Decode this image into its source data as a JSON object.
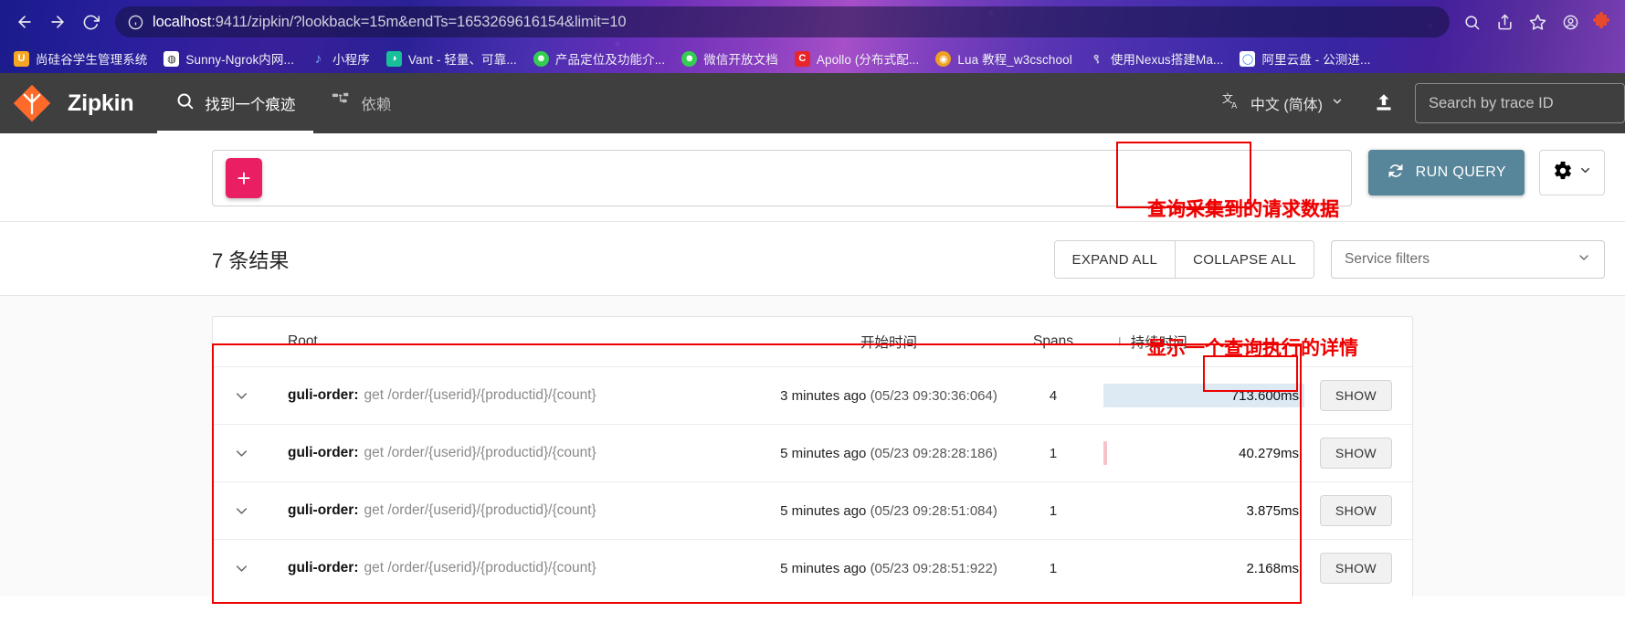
{
  "browser": {
    "back_label": "Back",
    "forward_label": "Forward",
    "reload_label": "Reload",
    "url_host": "localhost",
    "url_rest": ":9411/zipkin/?lookback=15m&endTs=1653269616154&limit=10",
    "icons": {
      "info": "info-icon",
      "zoom": "zoom-icon",
      "share": "share-icon",
      "star": "star-icon",
      "profile": "profile-icon",
      "extensions": "puzzle-icon"
    },
    "bookmarks": [
      {
        "label": "尚硅谷学生管理系统",
        "glyph": "U",
        "color": "#f5a623"
      },
      {
        "label": "Sunny-Ngrok内网...",
        "glyph": "◍",
        "color": "#ffffff"
      },
      {
        "label": "小程序",
        "glyph": "♪",
        "color": "#5a9cff"
      },
      {
        "label": "Vant - 轻量、可靠...",
        "glyph": "◑",
        "color": "#19be6b"
      },
      {
        "label": "产品定位及功能介...",
        "glyph": "☻",
        "color": "#35cd51"
      },
      {
        "label": "微信开放文档",
        "glyph": "☻",
        "color": "#35cd51"
      },
      {
        "label": "Apollo (分布式配...",
        "glyph": "C",
        "color": "#e8252a"
      },
      {
        "label": "Lua 教程_w3cschool",
        "glyph": "◉",
        "color": "#f0a020"
      },
      {
        "label": "使用Nexus搭建Ma...",
        "glyph": "९",
        "color": "#b0b0c8"
      },
      {
        "label": "阿里云盘 - 公测进...",
        "glyph": "◯",
        "color": "#2a7fff"
      }
    ]
  },
  "zipkin": {
    "brand": "Zipkin",
    "nav": [
      {
        "label": "找到一个痕迹",
        "icon": "search-icon",
        "active": true
      },
      {
        "label": "依赖",
        "icon": "dependency-icon",
        "active": false
      }
    ],
    "language": "中文 (简体)",
    "trace_search_placeholder": "Search by trace ID",
    "query": {
      "add_criteria_label": "+",
      "run_query_label": "RUN QUERY"
    },
    "results": {
      "count_label": "7 条结果",
      "expand_all": "EXPAND ALL",
      "collapse_all": "COLLAPSE ALL",
      "service_filter_placeholder": "Service filters"
    },
    "table": {
      "columns": {
        "root": "Root",
        "start_time": "开始时间",
        "spans": "Spans",
        "duration": "持续时间",
        "sort_arrow": "↓"
      },
      "show_label": "SHOW",
      "rows": [
        {
          "service": "guli-order:",
          "operation": "get /order/{userid}/{productid}/{count}",
          "relative_time": "3 minutes ago",
          "absolute_time": "(05/23 09:30:36:064)",
          "spans": "4",
          "duration": "713.600ms",
          "bar_width_pct": 100,
          "bar_style": "wide"
        },
        {
          "service": "guli-order:",
          "operation": "get /order/{userid}/{productid}/{count}",
          "relative_time": "5 minutes ago",
          "absolute_time": "(05/23 09:28:28:186)",
          "spans": "1",
          "duration": "40.279ms",
          "bar_width_pct": 3,
          "bar_style": "thin"
        },
        {
          "service": "guli-order:",
          "operation": "get /order/{userid}/{productid}/{count}",
          "relative_time": "5 minutes ago",
          "absolute_time": "(05/23 09:28:51:084)",
          "spans": "1",
          "duration": "3.875ms",
          "bar_width_pct": 0,
          "bar_style": "none"
        },
        {
          "service": "guli-order:",
          "operation": "get /order/{userid}/{productid}/{count}",
          "relative_time": "5 minutes ago",
          "absolute_time": "(05/23 09:28:51:922)",
          "spans": "1",
          "duration": "2.168ms",
          "bar_width_pct": 0,
          "bar_style": "none"
        }
      ]
    }
  },
  "annotations": {
    "run_query_note": "查询采集到的请求数据",
    "show_note": "显示一个查询执行的详情",
    "color": "#ee0000"
  }
}
